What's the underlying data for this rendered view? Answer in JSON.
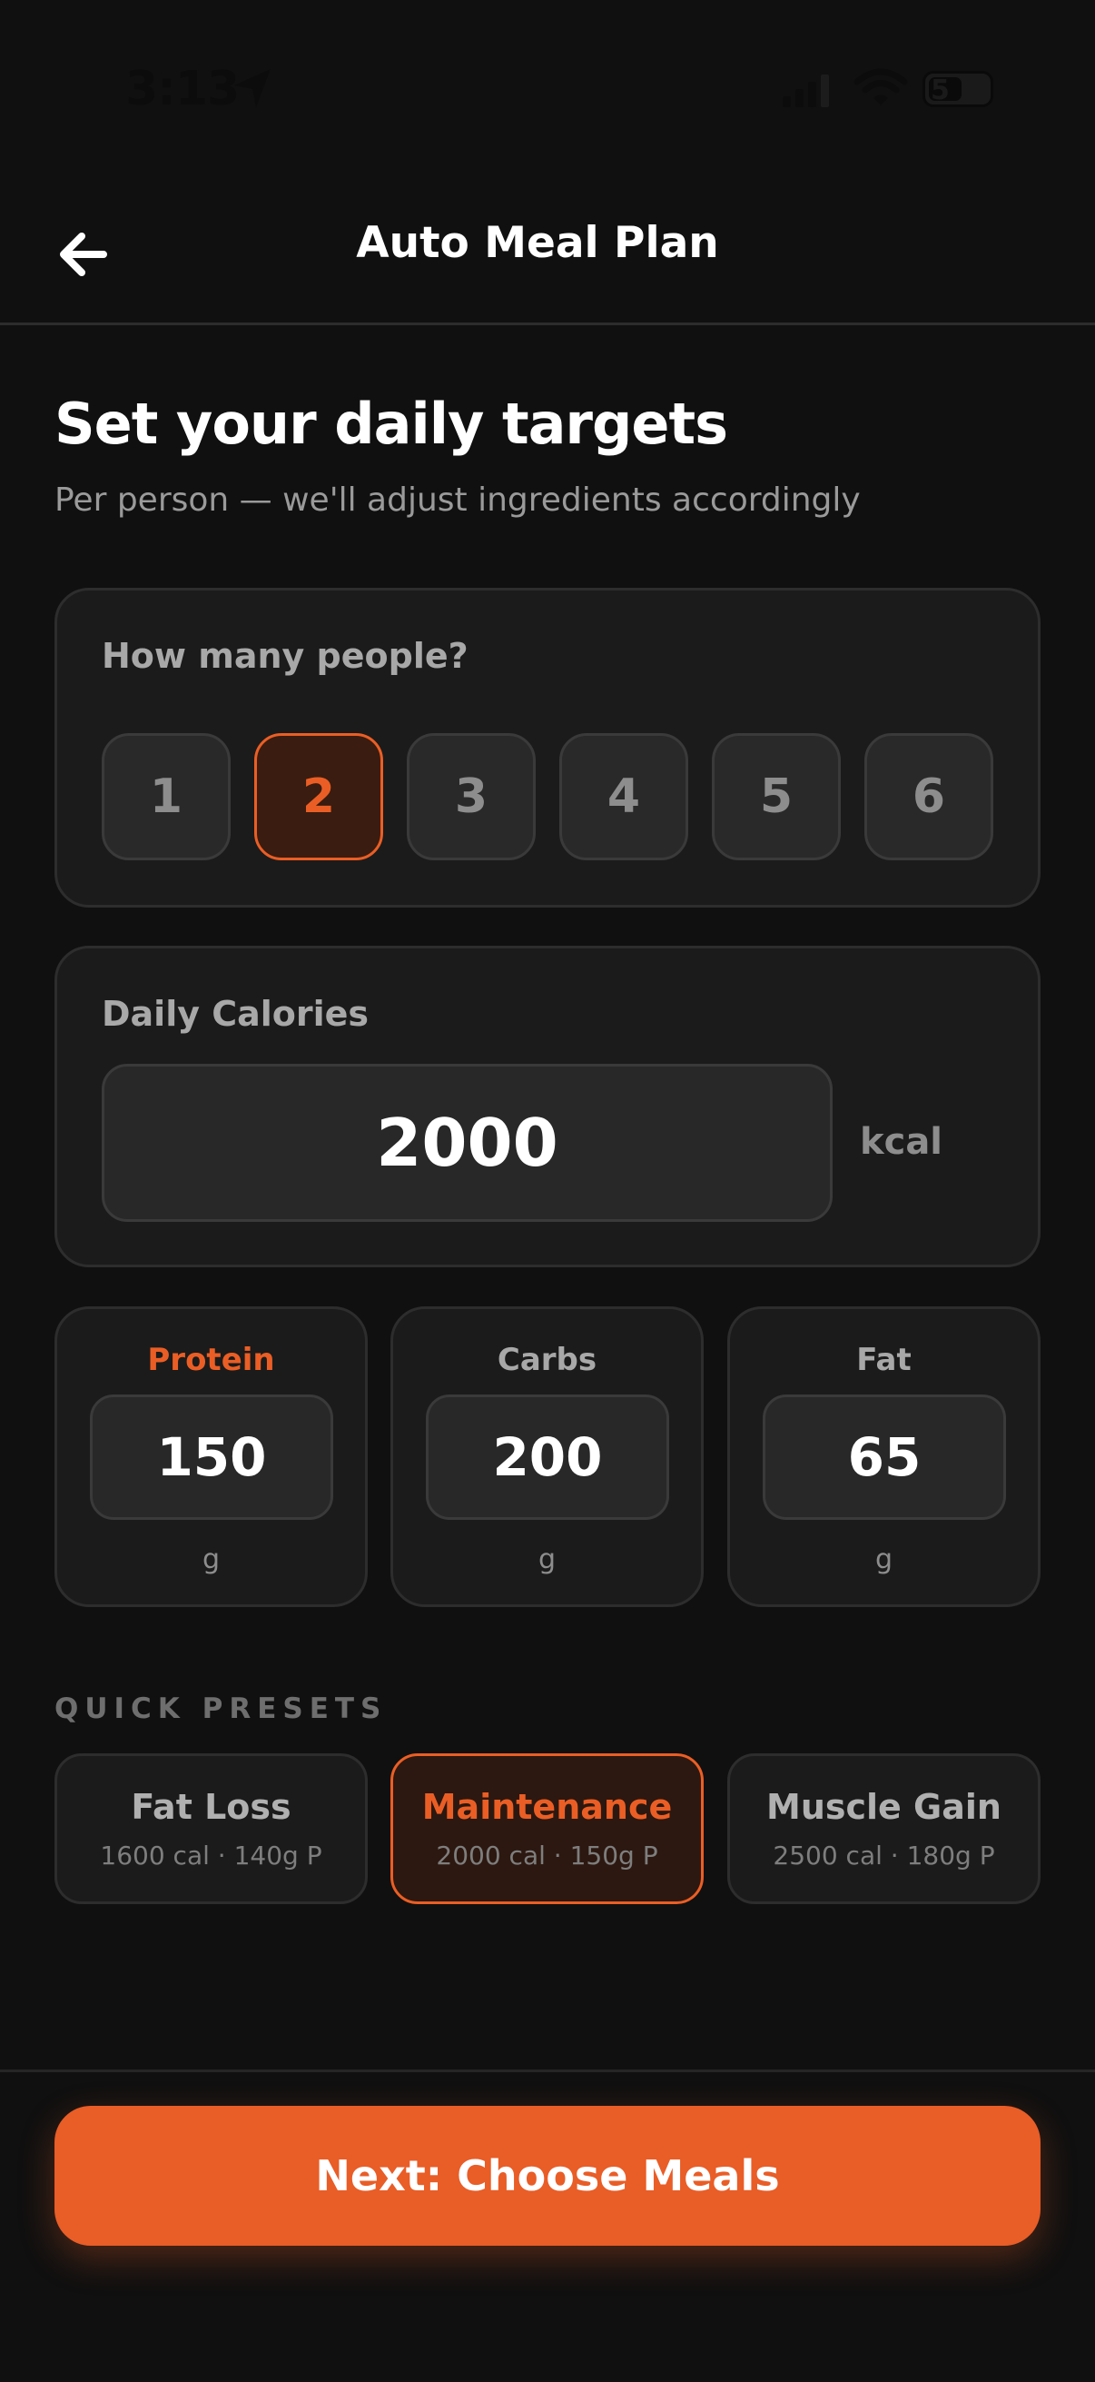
{
  "status_bar": {
    "time": "3:13",
    "battery": "5"
  },
  "header": {
    "title": "Auto Meal Plan"
  },
  "intro": {
    "title": "Set your daily targets",
    "subtitle": "Per person — we'll adjust ingredients accordingly"
  },
  "people": {
    "label": "How many people?",
    "options": [
      "1",
      "2",
      "3",
      "4",
      "5",
      "6"
    ],
    "selected": "2"
  },
  "calories": {
    "label": "Daily Calories",
    "value": "2000",
    "unit": "kcal"
  },
  "macros": [
    {
      "label": "Protein",
      "value": "150",
      "unit": "g"
    },
    {
      "label": "Carbs",
      "value": "200",
      "unit": "g"
    },
    {
      "label": "Fat",
      "value": "65",
      "unit": "g"
    }
  ],
  "presets": {
    "heading": "QUICK PRESETS",
    "items": [
      {
        "name": "Fat Loss",
        "detail": "1600 cal · 140g P"
      },
      {
        "name": "Maintenance",
        "detail": "2000 cal · 150g P"
      },
      {
        "name": "Muscle Gain",
        "detail": "2500 cal · 180g P"
      }
    ],
    "selected": "Maintenance"
  },
  "footer": {
    "next_label": "Next: Choose Meals"
  },
  "colors": {
    "accent": "#ea5e25",
    "background": "#101010",
    "card": "#1b1b1b"
  },
  "icons": {
    "back": "arrow-left-icon",
    "location": "location-arrow-icon",
    "signal": "signal-bars-icon",
    "wifi": "wifi-icon",
    "battery": "battery-icon"
  }
}
